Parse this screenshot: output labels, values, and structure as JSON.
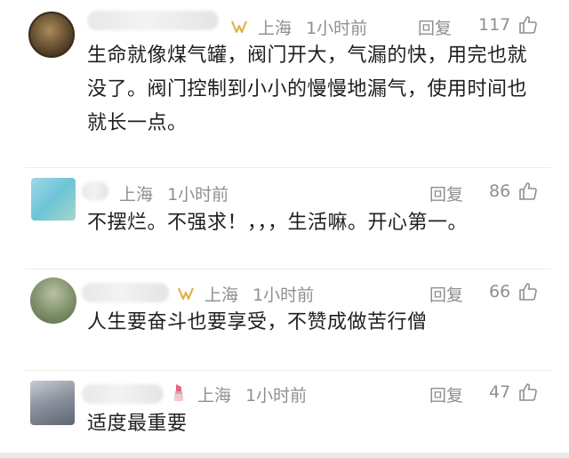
{
  "comments": [
    {
      "location": "上海",
      "time": "1小时前",
      "reply_label": "回复",
      "likes": "117",
      "text": "生命就像煤气罐，阀门开大，气漏的快，用完也就没了。阀门控制到小小的慢慢地漏气，使用时间也就长一点。"
    },
    {
      "location": "上海",
      "time": "1小时前",
      "reply_label": "回复",
      "likes": "86",
      "text": "不摆烂。不强求！，，，生活嘛。开心第一。"
    },
    {
      "location": "上海",
      "time": "1小时前",
      "reply_label": "回复",
      "likes": "66",
      "text": "人生要奋斗也要享受，不赞成做苦行僧"
    },
    {
      "location": "上海",
      "time": "1小时前",
      "reply_label": "回复",
      "likes": "47",
      "text": "适度最重要"
    }
  ],
  "colors": {
    "meta_text": "#8f8f8f",
    "body_text": "#1f1f1f",
    "badge_gold": "#e0b24a",
    "lipstick": "#e46a7a"
  }
}
